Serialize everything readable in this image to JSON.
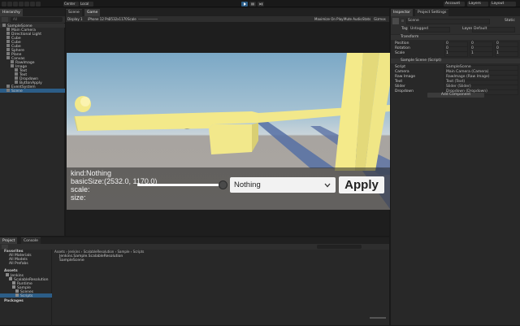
{
  "toolbar": {
    "left_tools": [
      "Center",
      "Local"
    ],
    "play_icons": [
      "play-icon",
      "pause-icon",
      "step-icon"
    ],
    "account": "Account",
    "layers": "Layers",
    "layout": "Layout"
  },
  "hierarchy": {
    "tab": "Hierarchy",
    "search_placeholder": "All",
    "items": [
      {
        "label": "SampleScene",
        "indent": 0
      },
      {
        "label": "Main Camera",
        "indent": 1
      },
      {
        "label": "Directional Light",
        "indent": 1
      },
      {
        "label": "Cube",
        "indent": 1
      },
      {
        "label": "Cube",
        "indent": 1
      },
      {
        "label": "Cube",
        "indent": 1
      },
      {
        "label": "Sphere",
        "indent": 1
      },
      {
        "label": "Plane",
        "indent": 1
      },
      {
        "label": "Canvas",
        "indent": 1
      },
      {
        "label": "RawImage",
        "indent": 2
      },
      {
        "label": "Image",
        "indent": 2
      },
      {
        "label": "Text",
        "indent": 3
      },
      {
        "label": "Text",
        "indent": 3
      },
      {
        "label": "Dropdown",
        "indent": 3
      },
      {
        "label": "ButtonApply",
        "indent": 3
      },
      {
        "label": "EventSystem",
        "indent": 1
      },
      {
        "label": "Scene",
        "indent": 1
      }
    ]
  },
  "center_tabs": [
    "Scene",
    "Game"
  ],
  "game_toolbar": {
    "display": "Display 1",
    "device": "iPhone 12 Pro",
    "resolution": "2532x1170",
    "scale_label": "Scale",
    "maximize": "Maximize On Play",
    "mute": "Mute Audio",
    "stats": "Stats",
    "gizmos": "Gizmos"
  },
  "game_view": {
    "info_lines": [
      "kind:Nothing",
      "basicSize:(2532.0, 1170.0)",
      "scale:",
      "size:"
    ],
    "dropdown_value": "Nothing",
    "apply_label": "Apply",
    "slider_value": 1.0
  },
  "project_panel": {
    "tabs": [
      "Project",
      "Console"
    ],
    "breadcrumb": [
      "Assets",
      "Jenkins",
      "ScalableResolution",
      "Sample",
      "Scripts"
    ],
    "favorites_label": "Favorites",
    "favorites": [
      "All Materials",
      "All Models",
      "All Prefabs"
    ],
    "assets_label": "Assets",
    "tree": [
      {
        "label": "Jenkins",
        "indent": 1
      },
      {
        "label": "ScalableResolution",
        "indent": 2
      },
      {
        "label": "Runtime",
        "indent": 3
      },
      {
        "label": "Sample",
        "indent": 3
      },
      {
        "label": "Scenes",
        "indent": 4
      },
      {
        "label": "Scripts",
        "indent": 4
      }
    ],
    "packages_label": "Packages",
    "files": [
      "Jenkins.Sample.ScalableResolution",
      "SampleScene"
    ]
  },
  "inspector": {
    "tabs": [
      "Inspector",
      "Project Settings"
    ],
    "object_name": "Scene",
    "static_label": "Static",
    "tag_label": "Tag",
    "tag_value": "Untagged",
    "layer_label": "Layer",
    "layer_value": "Default",
    "transform_label": "Transform",
    "transform_rows": [
      {
        "label": "Position",
        "x": "0",
        "y": "0",
        "z": "0"
      },
      {
        "label": "Rotation",
        "x": "0",
        "y": "0",
        "z": "0"
      },
      {
        "label": "Scale",
        "x": "1",
        "y": "1",
        "z": "1"
      }
    ],
    "script_component": "Sample Scene (Script)",
    "script_rows": [
      {
        "label": "Script",
        "value": "SampleScene"
      },
      {
        "label": "Camera",
        "value": "Main Camera (Camera)"
      },
      {
        "label": "Raw Image",
        "value": "RawImage (Raw Image)"
      },
      {
        "label": "Text",
        "value": "Text (Text)"
      },
      {
        "label": "Slider",
        "value": "Slider (Slider)"
      },
      {
        "label": "Dropdown",
        "value": "Dropdown (Dropdown)"
      }
    ],
    "add_component": "Add Component"
  },
  "colors": {
    "accent": "#2c5d87",
    "yellow": "#f4ea8a",
    "sky_top": "#7aa9c8",
    "ground": "#a9a5a0"
  }
}
